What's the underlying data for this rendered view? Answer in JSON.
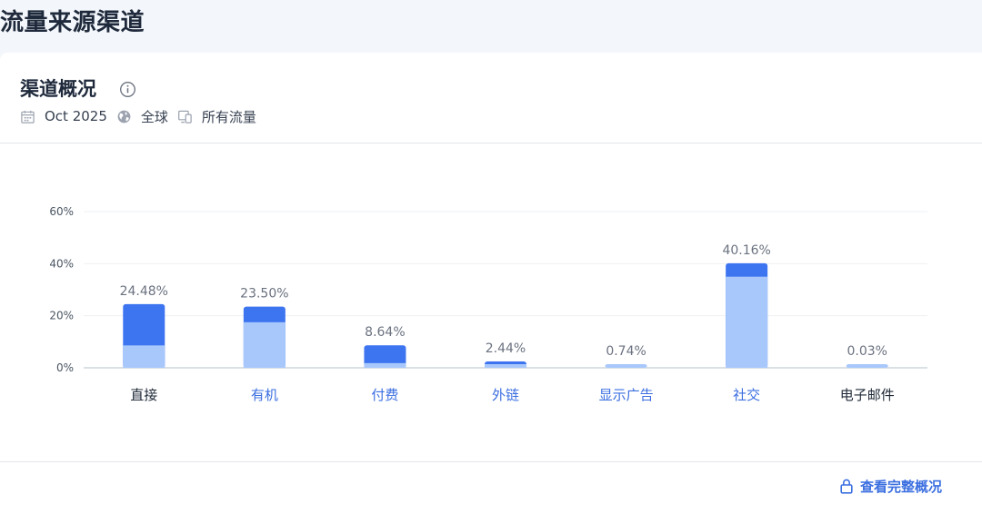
{
  "page": {
    "title": "流量来源渠道"
  },
  "card": {
    "title": "渠道概况",
    "info_icon": "info-icon",
    "meta": [
      {
        "icon": "calendar-icon",
        "text": "Oct 2025"
      },
      {
        "icon": "globe-icon",
        "text": "全球"
      },
      {
        "icon": "devices-icon",
        "text": "所有流量"
      }
    ],
    "footer_link": {
      "icon": "lock-icon",
      "label": "查看完整概况"
    }
  },
  "colors": {
    "dark_bar": "#3d74f0",
    "light_bar": "#a8c8fc",
    "link_label": "#3b6fe0",
    "default_label": "#1f2937",
    "value_label": "#6b7280",
    "grid": "#eef0f3",
    "axis": "#cfd5dc"
  },
  "chart_data": {
    "type": "bar",
    "stacked": true,
    "categories": [
      "直接",
      "有机",
      "付费",
      "外链",
      "显示广告",
      "社交",
      "电子邮件"
    ],
    "category_is_link": [
      false,
      true,
      true,
      true,
      true,
      true,
      false
    ],
    "series": [
      {
        "values": [
          8.6,
          17.5,
          1.8,
          1.0,
          0.74,
          35.0,
          0.03
        ]
      },
      {
        "values": [
          15.88,
          6.0,
          6.84,
          1.44,
          0.0,
          5.16,
          0.0
        ]
      }
    ],
    "totals_labels": [
      "24.48%",
      "23.50%",
      "8.64%",
      "2.44%",
      "0.74%",
      "40.16%",
      "0.03%"
    ],
    "totals": [
      24.48,
      23.5,
      8.64,
      2.44,
      0.74,
      40.16,
      0.03
    ],
    "y_ticks": [
      "0%",
      "20%",
      "40%",
      "60%"
    ],
    "y_tick_values": [
      0,
      20,
      40,
      60
    ],
    "ylim": [
      0,
      60
    ],
    "grid": true,
    "legend": "none",
    "title": "",
    "xlabel": "",
    "ylabel": ""
  }
}
